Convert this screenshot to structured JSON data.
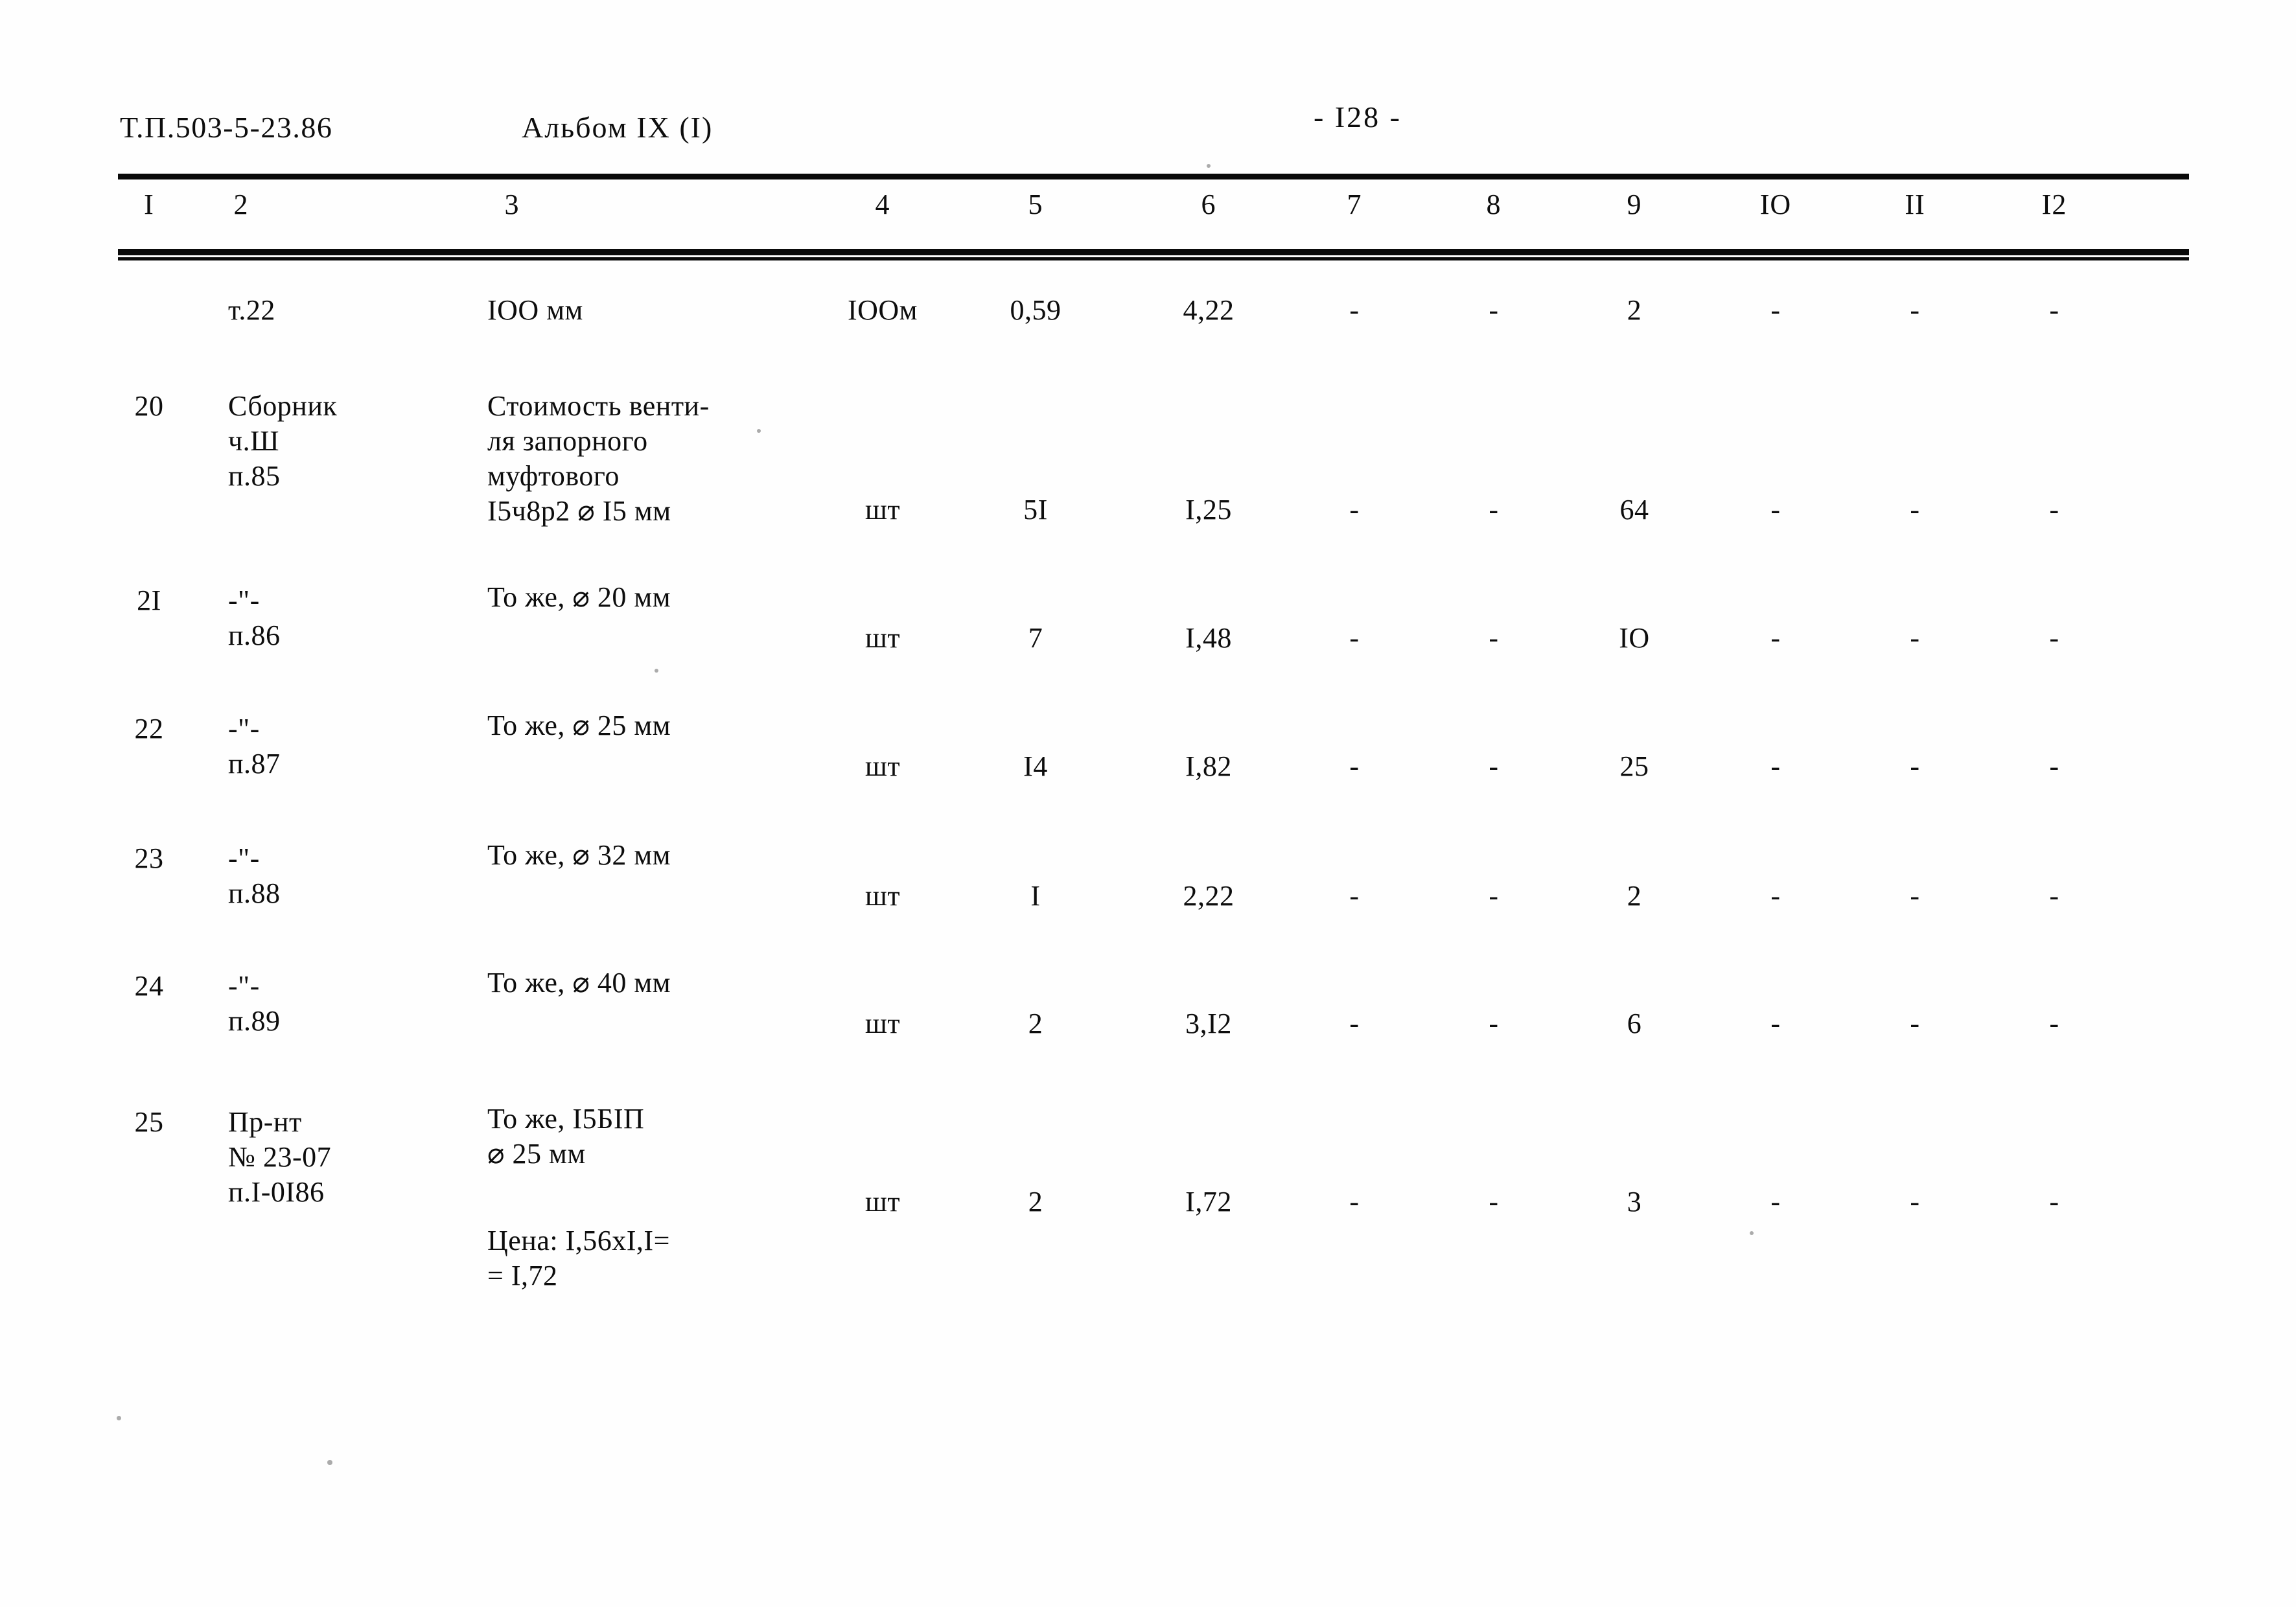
{
  "document": {
    "code": "Т.П.503-5-23.86",
    "album": "Альбом IX (I)",
    "page_number": "- I28 -"
  },
  "table": {
    "column_headers": [
      "I",
      "2",
      "3",
      "4",
      "5",
      "6",
      "7",
      "8",
      "9",
      "IO",
      "II",
      "I2"
    ],
    "rows": [
      {
        "id": "row-cont",
        "c1": "",
        "c2": "т.22",
        "c3": "IOO мм",
        "c4": "IOOм",
        "c5": "0,59",
        "c6": "4,22",
        "c7": "-",
        "c8": "-",
        "c9": "2",
        "c10": "-",
        "c11": "-",
        "c12": "-"
      },
      {
        "id": "row-20",
        "c1": "20",
        "c2": "Сборник\nч.Ш\nп.85",
        "c3": "Стоимость венти-\nля запорного\nмуфтового\nI5ч8р2 ⌀ I5 мм",
        "c4": "шт",
        "c5": "5I",
        "c6": "I,25",
        "c7": "-",
        "c8": "-",
        "c9": "64",
        "c10": "-",
        "c11": "-",
        "c12": "-"
      },
      {
        "id": "row-21",
        "c1": "2I",
        "c2": "-\"-\nп.86",
        "c3": "То же, ⌀ 20 мм",
        "c4": "шт",
        "c5": "7",
        "c6": "I,48",
        "c7": "-",
        "c8": "-",
        "c9": "IO",
        "c10": "-",
        "c11": "-",
        "c12": "-"
      },
      {
        "id": "row-22",
        "c1": "22",
        "c2": "-\"-\nп.87",
        "c3": "То же, ⌀ 25 мм",
        "c4": "шт",
        "c5": "I4",
        "c6": "I,82",
        "c7": "-",
        "c8": "-",
        "c9": "25",
        "c10": "-",
        "c11": "-",
        "c12": "-"
      },
      {
        "id": "row-23",
        "c1": "23",
        "c2": "-\"-\nп.88",
        "c3": "То же, ⌀ 32 мм",
        "c4": "шт",
        "c5": "I",
        "c6": "2,22",
        "c7": "-",
        "c8": "-",
        "c9": "2",
        "c10": "-",
        "c11": "-",
        "c12": "-"
      },
      {
        "id": "row-24",
        "c1": "24",
        "c2": "-\"-\nп.89",
        "c3": "То же, ⌀ 40 мм",
        "c4": "шт",
        "c5": "2",
        "c6": "3,I2",
        "c7": "-",
        "c8": "-",
        "c9": "6",
        "c10": "-",
        "c11": "-",
        "c12": "-"
      },
      {
        "id": "row-25",
        "c1": "25",
        "c2": "Пр-нт\n№ 23-07\nп.I-0I86",
        "c3": "То же, I5БIП\n⌀ 25 мм",
        "c3b": "Цена: I,56xI,I=\n= I,72",
        "c4": "шт",
        "c5": "2",
        "c6": "I,72",
        "c7": "-",
        "c8": "-",
        "c9": "3",
        "c10": "-",
        "c11": "-",
        "c12": "-"
      }
    ]
  }
}
